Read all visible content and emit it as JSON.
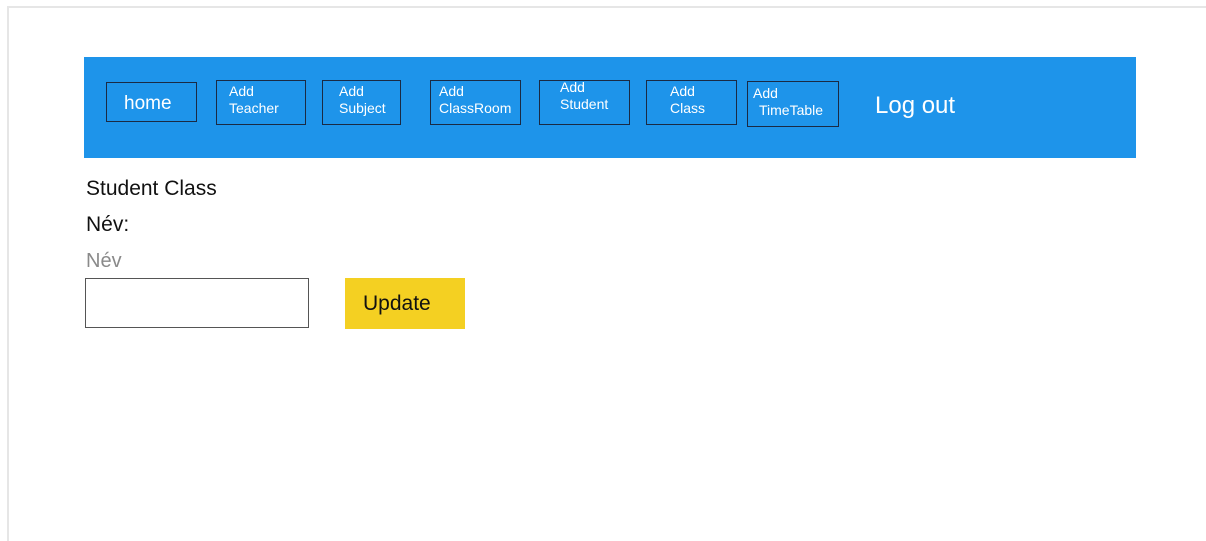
{
  "nav": {
    "home": "home",
    "buttons": [
      {
        "line1": "Add",
        "line2": "Teacher"
      },
      {
        "line1": "Add",
        "line2": "Subject"
      },
      {
        "line1": "Add",
        "line2": "ClassRoom"
      },
      {
        "line1": "Add",
        "line2": "Student"
      },
      {
        "line1": "Add",
        "line2": "Class"
      },
      {
        "line1": "Add",
        "line2": "TimeTable"
      }
    ],
    "logout": "Log out"
  },
  "form": {
    "title": "Student Class",
    "name_label": "Név:",
    "field_caption": "Név",
    "name_value": "",
    "update_label": "Update"
  },
  "colors": {
    "navbar": "#1e94ea",
    "update_button": "#f4d022"
  }
}
